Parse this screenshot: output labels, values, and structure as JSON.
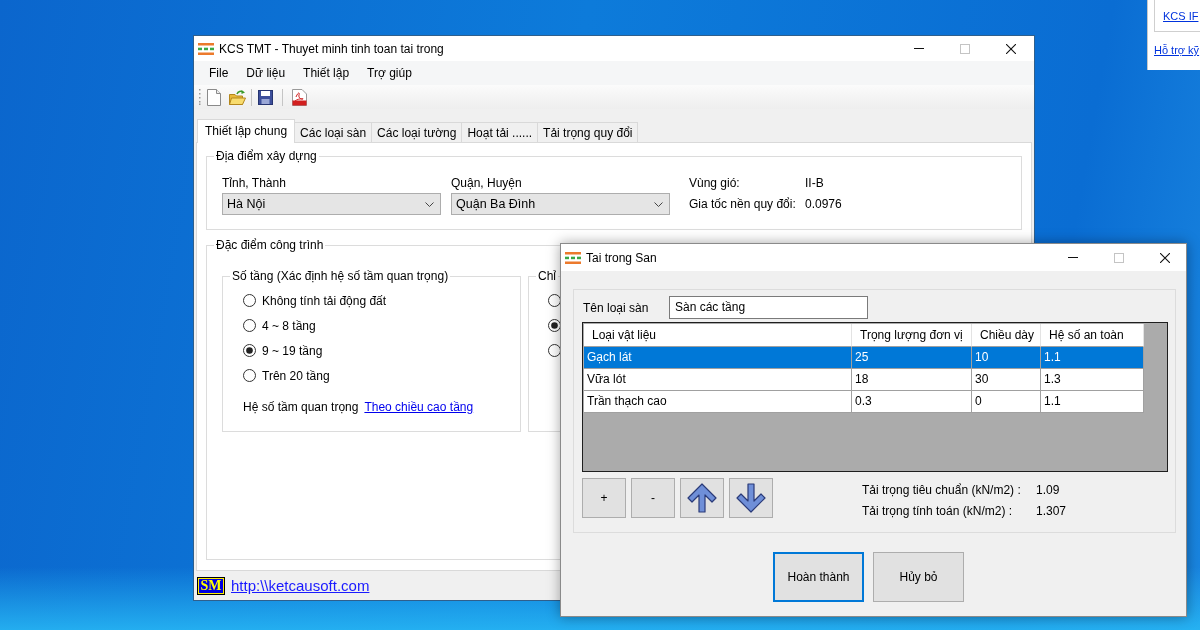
{
  "desktop_panel": {
    "boxed_links": [
      "KCS IF"
    ],
    "links": [
      "Hỗ trợ kỹ"
    ]
  },
  "main_window": {
    "title": "KCS TMT - Thuyet minh tinh toan tai trong",
    "window_buttons": [
      {
        "kind": "minimize",
        "disabled": false
      },
      {
        "kind": "maximize",
        "disabled": true
      },
      {
        "kind": "close",
        "disabled": false
      }
    ],
    "menu": [
      "File",
      "Dữ liệu",
      "Thiết lập",
      "Trợ giúp"
    ],
    "tabs": [
      {
        "label": "Thiết lập chung",
        "selected": true
      },
      {
        "label": "Các loại sàn",
        "selected": false
      },
      {
        "label": "Các loại tường",
        "selected": false
      },
      {
        "label": "Hoạt tải ......",
        "selected": false
      },
      {
        "label": "Tải trọng quy đổi",
        "selected": false
      }
    ],
    "location_group": {
      "title": "Địa điểm xây dựng",
      "dropdowns": [
        {
          "label": "Tỉnh, Thành",
          "value": "Hà Nội"
        },
        {
          "label": "Quận, Huyện",
          "value": "Quận Ba Đình"
        }
      ],
      "info": [
        {
          "label": "Vùng gió:",
          "value": "II-B"
        },
        {
          "label": "Gia tốc nền quy đổi:",
          "value": "0.0976"
        }
      ]
    },
    "building_group": {
      "title": "Đặc điểm công trình",
      "floors_group": {
        "title": "Số tầng (Xác định hệ số tầm quan trọng)",
        "options": [
          {
            "label": "Không tính tải động đất",
            "selected": false
          },
          {
            "label": "4 ~ 8 tầng",
            "selected": false
          },
          {
            "label": "9 ~ 19 tầng",
            "selected": true
          },
          {
            "label": "Trên 20 tầng",
            "selected": false
          }
        ],
        "importance_label": "Hệ số tầm quan trọng",
        "importance_link": "Theo chiều cao tầng"
      },
      "group_2": {
        "title": "Chỉ",
        "options": [
          {
            "selected": false
          },
          {
            "selected": true
          },
          {
            "selected": false
          }
        ]
      }
    },
    "footer": {
      "logo": "SM",
      "link": "http:\\\\ketcausoft.com"
    }
  },
  "dialog": {
    "title": "Tai trong San",
    "window_buttons": [
      {
        "kind": "minimize",
        "disabled": false
      },
      {
        "kind": "maximize",
        "disabled": true
      },
      {
        "kind": "close",
        "disabled": false
      }
    ],
    "name_field": {
      "label": "Tên loại sàn",
      "value": "Sàn các tầng"
    },
    "table": {
      "columns": [
        "Loại vật liệu",
        "Trọng lượng đơn vị",
        "Chiều dày",
        "Hệ số an toàn"
      ],
      "rows": [
        {
          "cells": [
            "Gạch lát",
            "25",
            "10",
            "1.1"
          ],
          "selected": true
        },
        {
          "cells": [
            "Vữa lót",
            "18",
            "30",
            "1.3"
          ],
          "selected": false
        },
        {
          "cells": [
            "Trần thạch cao",
            "0.3",
            "0",
            "1.1"
          ],
          "selected": false
        }
      ]
    },
    "row_buttons": [
      "+",
      "-"
    ],
    "results": [
      {
        "label": "Tải trọng tiêu chuẩn (kN/m2) :",
        "value": "1.09"
      },
      {
        "label": "Tải trọng tính toán (kN/m2) :",
        "value": "1.307"
      }
    ],
    "buttons": [
      {
        "label": "Hoàn thành",
        "focused": true
      },
      {
        "label": "Hủy bỏ",
        "focused": false
      }
    ]
  }
}
